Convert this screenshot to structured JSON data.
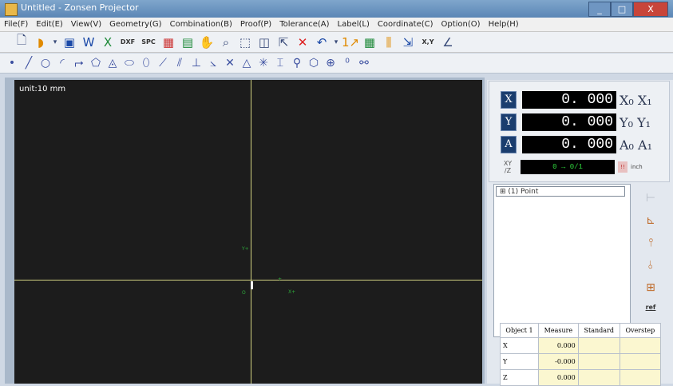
{
  "window": {
    "title": "Untitled - Zonsen Projector",
    "minimize": "_",
    "maximize": "□",
    "close": "X"
  },
  "menu": [
    "File(F)",
    "Edit(E)",
    "View(V)",
    "Geometry(G)",
    "Combination(B)",
    "Proof(P)",
    "Tolerance(A)",
    "Label(L)",
    "Coordinate(C)",
    "Option(O)",
    "Help(H)"
  ],
  "toolbar": {
    "dxf": "DXF",
    "spc": "SPC",
    "xy": "X,Y"
  },
  "canvas": {
    "unit_label": "unit:10 mm",
    "marker_y": "Y+",
    "marker_o": "O",
    "marker_x": "X+"
  },
  "readout": {
    "x_label": "X",
    "x_value": "0. 000",
    "x_units": "X₀ X₁",
    "y_label": "Y",
    "y_value": "0. 000",
    "y_units": "Y₀ Y₁",
    "a_label": "A",
    "a_value": "0. 000",
    "a_units": "A₀ A₁",
    "counter": "0 → 0/1",
    "inch": "inch"
  },
  "feature_list": {
    "selected": "(1) Point"
  },
  "results_table": {
    "headers": [
      "Object 1",
      "Measure",
      "Standard",
      "Overstep"
    ],
    "rows": [
      {
        "label": "X",
        "measure": "0.000"
      },
      {
        "label": "Y",
        "measure": "-0.000"
      },
      {
        "label": "Z",
        "measure": "0.000"
      }
    ]
  }
}
